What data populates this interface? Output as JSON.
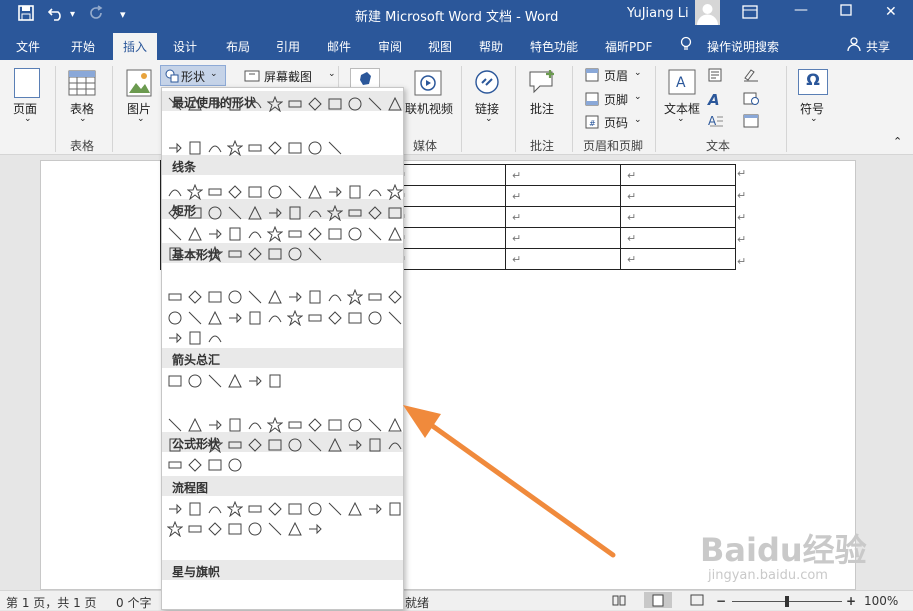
{
  "window": {
    "title": "新建 Microsoft Word 文档  -  Word",
    "user": "YuJiang Li"
  },
  "tabs": [
    "文件",
    "开始",
    "插入",
    "设计",
    "布局",
    "引用",
    "邮件",
    "审阅",
    "视图",
    "帮助",
    "特色功能",
    "福昕PDF",
    "操作说明搜索",
    "共享"
  ],
  "ribbon": {
    "page_label": "页面",
    "table_label": "表格",
    "picture_label": "图片",
    "shapes_label": "形状",
    "screenshot_label": "屏幕截图",
    "online_video_label": "联机视频",
    "link_label": "链接",
    "comment_label": "批注",
    "header_label": "页眉",
    "footer_label": "页脚",
    "pagenum_label": "页码",
    "textbox_label": "文本框",
    "symbol_label": "符号",
    "group_table": "表格",
    "group_media": "媒体",
    "group_comment": "批注",
    "group_header_footer": "页眉和页脚",
    "group_text": "文本"
  },
  "shapes_menu": {
    "sections": [
      "最近使用的形状",
      "线条",
      "矩形",
      "基本形状",
      "箭头总汇",
      "公式形状",
      "流程图",
      "星与旗帜"
    ]
  },
  "document": {
    "para_mark": "↵"
  },
  "status": {
    "page": "第 1 页，共 1 页",
    "words": "0 个字",
    "ready": "就绪",
    "zoom": "100%"
  },
  "watermark": {
    "logo": "Baidu经验",
    "url": "jingyan.baidu.com"
  },
  "colors": {
    "accent": "#2b579a",
    "arrow": "#f08a3c"
  }
}
